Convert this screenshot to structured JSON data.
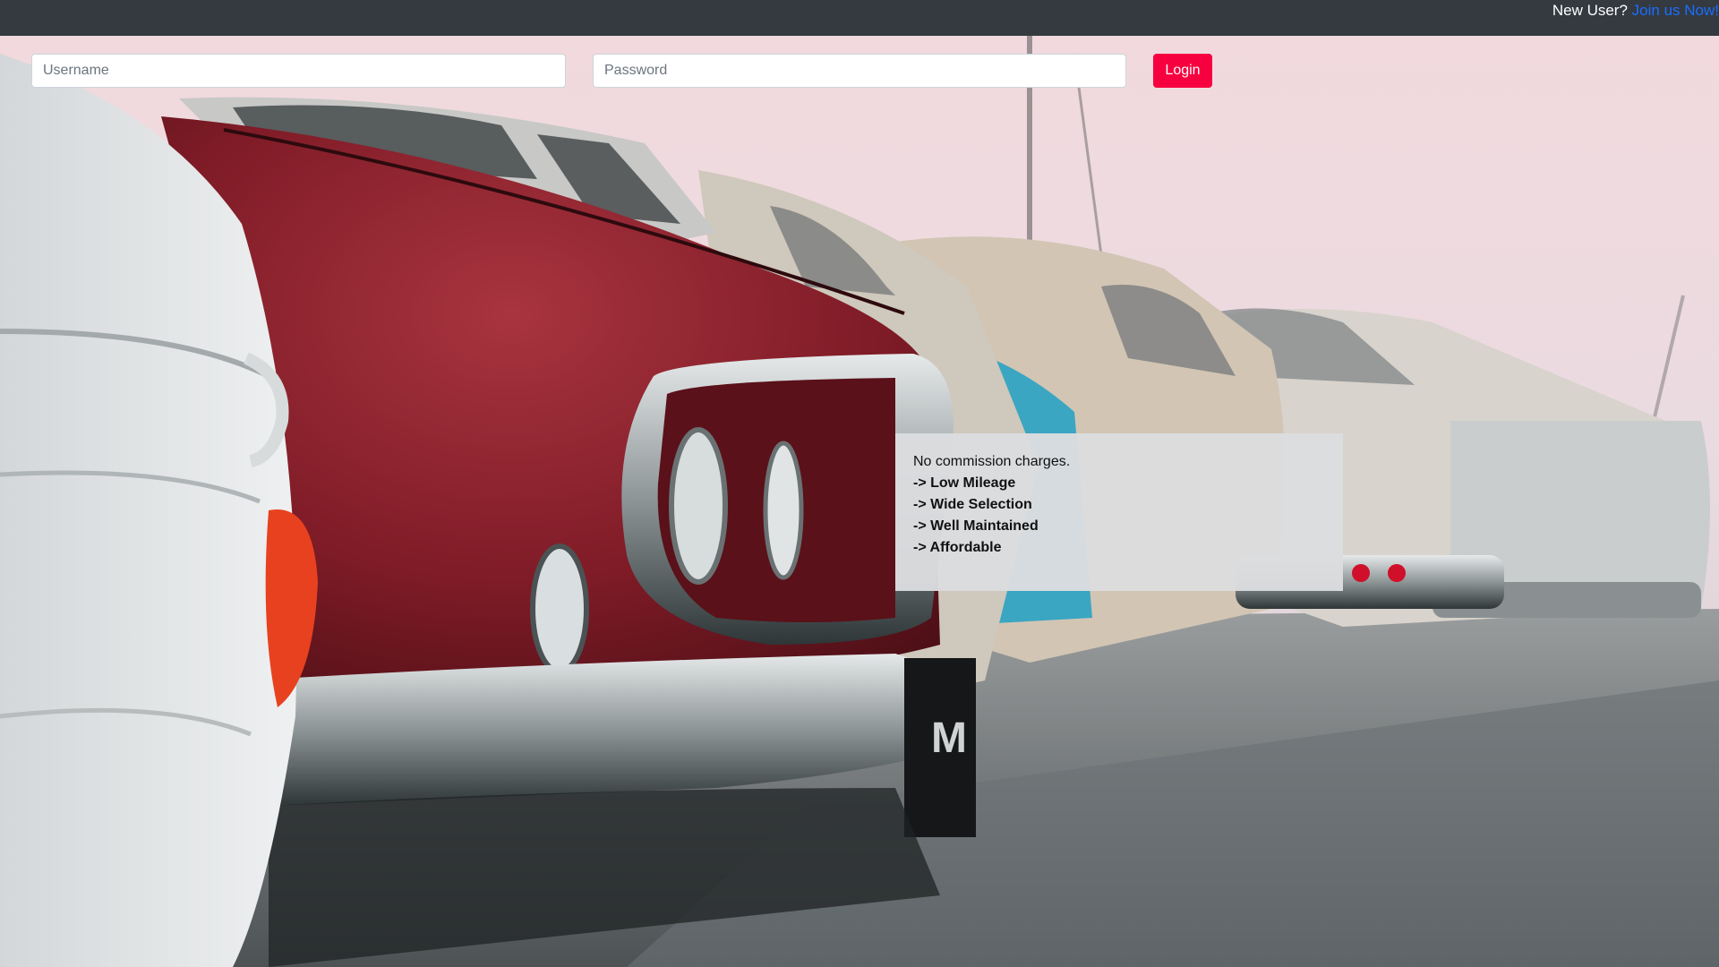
{
  "topbar": {
    "prompt_text": "New User?",
    "join_link": "Join us Now!"
  },
  "login": {
    "username_placeholder": "Username",
    "password_placeholder": "Password",
    "username_value": "",
    "password_value": "",
    "button_label": "Login"
  },
  "info": {
    "intro": "No commission charges.",
    "features": [
      "-> Low Mileage",
      "-> Wide Selection",
      "-> Well Maintained",
      "-> Affordable"
    ]
  },
  "colors": {
    "navbar": "#343a40",
    "link": "#1a6dff",
    "login_button": "#f7003f",
    "panel": "#dcdddf",
    "car_red": "#8c1f2c"
  },
  "background": {
    "subject": "vintage cars parked in a row, red car in foreground, rainy sky"
  }
}
